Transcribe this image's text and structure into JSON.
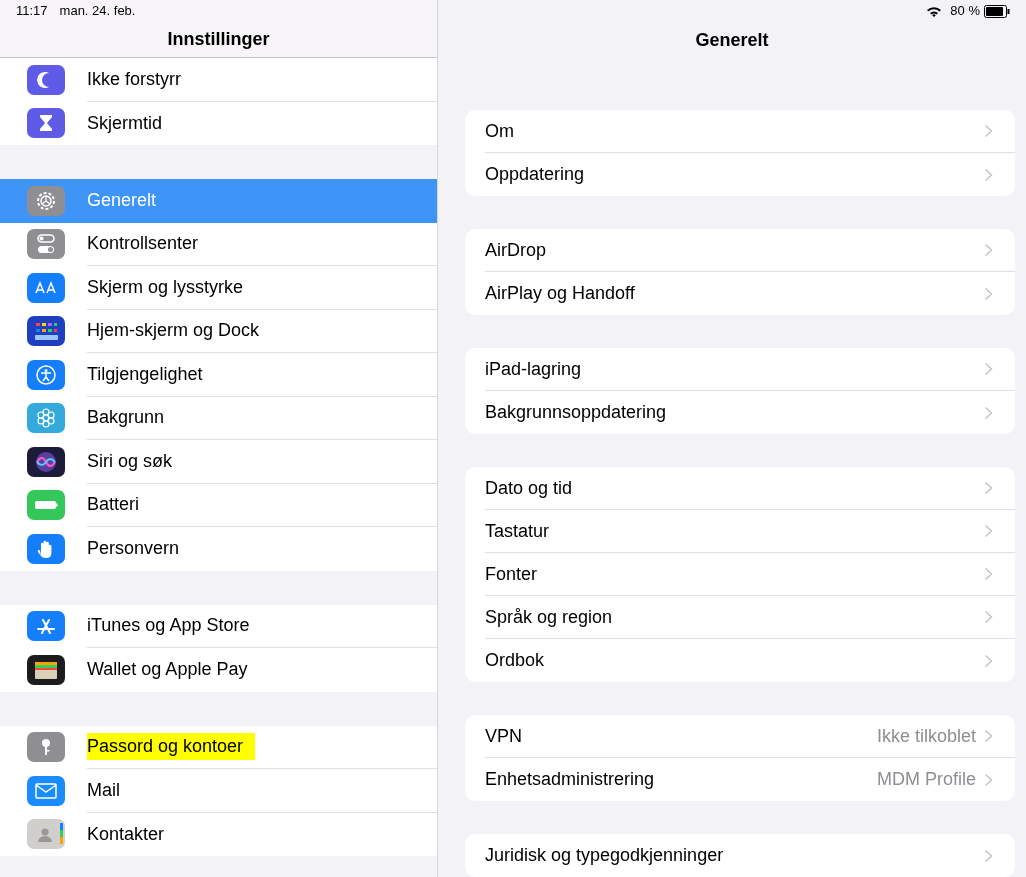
{
  "status_bar": {
    "time": "11:17",
    "date": "man. 24. feb.",
    "battery": "80 %"
  },
  "sidebar": {
    "title": "Innstillinger",
    "groups": [
      {
        "items": [
          {
            "label": "Ikke forstyrr",
            "kind": "moon",
            "selected": false,
            "highlighted": false
          },
          {
            "label": "Skjermtid",
            "kind": "hourglass",
            "selected": false,
            "highlighted": false
          }
        ]
      },
      {
        "items": [
          {
            "label": "Generelt",
            "kind": "gear",
            "selected": true,
            "highlighted": false
          },
          {
            "label": "Kontrollsenter",
            "kind": "toggles",
            "selected": false,
            "highlighted": false
          },
          {
            "label": "Skjerm og lysstyrke",
            "kind": "display",
            "selected": false,
            "highlighted": false
          },
          {
            "label": "Hjem-skjerm og Dock",
            "kind": "grid",
            "selected": false,
            "highlighted": false
          },
          {
            "label": "Tilgjengelighet",
            "kind": "person",
            "selected": false,
            "highlighted": false
          },
          {
            "label": "Bakgrunn",
            "kind": "flower",
            "selected": false,
            "highlighted": false
          },
          {
            "label": "Siri og søk",
            "kind": "siri",
            "selected": false,
            "highlighted": false
          },
          {
            "label": "Batteri",
            "kind": "battery",
            "selected": false,
            "highlighted": false
          },
          {
            "label": "Personvern",
            "kind": "hand",
            "selected": false,
            "highlighted": false
          }
        ]
      },
      {
        "items": [
          {
            "label": "iTunes og App Store",
            "kind": "store",
            "selected": false,
            "highlighted": false
          },
          {
            "label": "Wallet og Apple Pay",
            "kind": "wallet",
            "selected": false,
            "highlighted": false
          }
        ]
      },
      {
        "items": [
          {
            "label": "Passord og kontoer",
            "kind": "key",
            "selected": false,
            "highlighted": true
          },
          {
            "label": "Mail",
            "kind": "mail",
            "selected": false,
            "highlighted": false
          },
          {
            "label": "Kontakter",
            "kind": "contacts",
            "selected": false,
            "highlighted": false
          }
        ]
      }
    ]
  },
  "detail": {
    "title": "Generelt",
    "groups": [
      {
        "rows": [
          {
            "label": "Om"
          },
          {
            "label": "Oppdatering"
          }
        ]
      },
      {
        "rows": [
          {
            "label": "AirDrop"
          },
          {
            "label": "AirPlay og Handoff"
          }
        ]
      },
      {
        "rows": [
          {
            "label": "iPad-lagring"
          },
          {
            "label": "Bakgrunnsoppdatering"
          }
        ]
      },
      {
        "rows": [
          {
            "label": "Dato og tid"
          },
          {
            "label": "Tastatur"
          },
          {
            "label": "Fonter"
          },
          {
            "label": "Språk og region"
          },
          {
            "label": "Ordbok"
          }
        ]
      },
      {
        "rows": [
          {
            "label": "VPN",
            "value": "Ikke tilkoblet"
          },
          {
            "label": "Enhetsadministrering",
            "value": "MDM Profile"
          }
        ]
      },
      {
        "rows": [
          {
            "label": "Juridisk og typegodkjenninger"
          }
        ]
      }
    ]
  }
}
